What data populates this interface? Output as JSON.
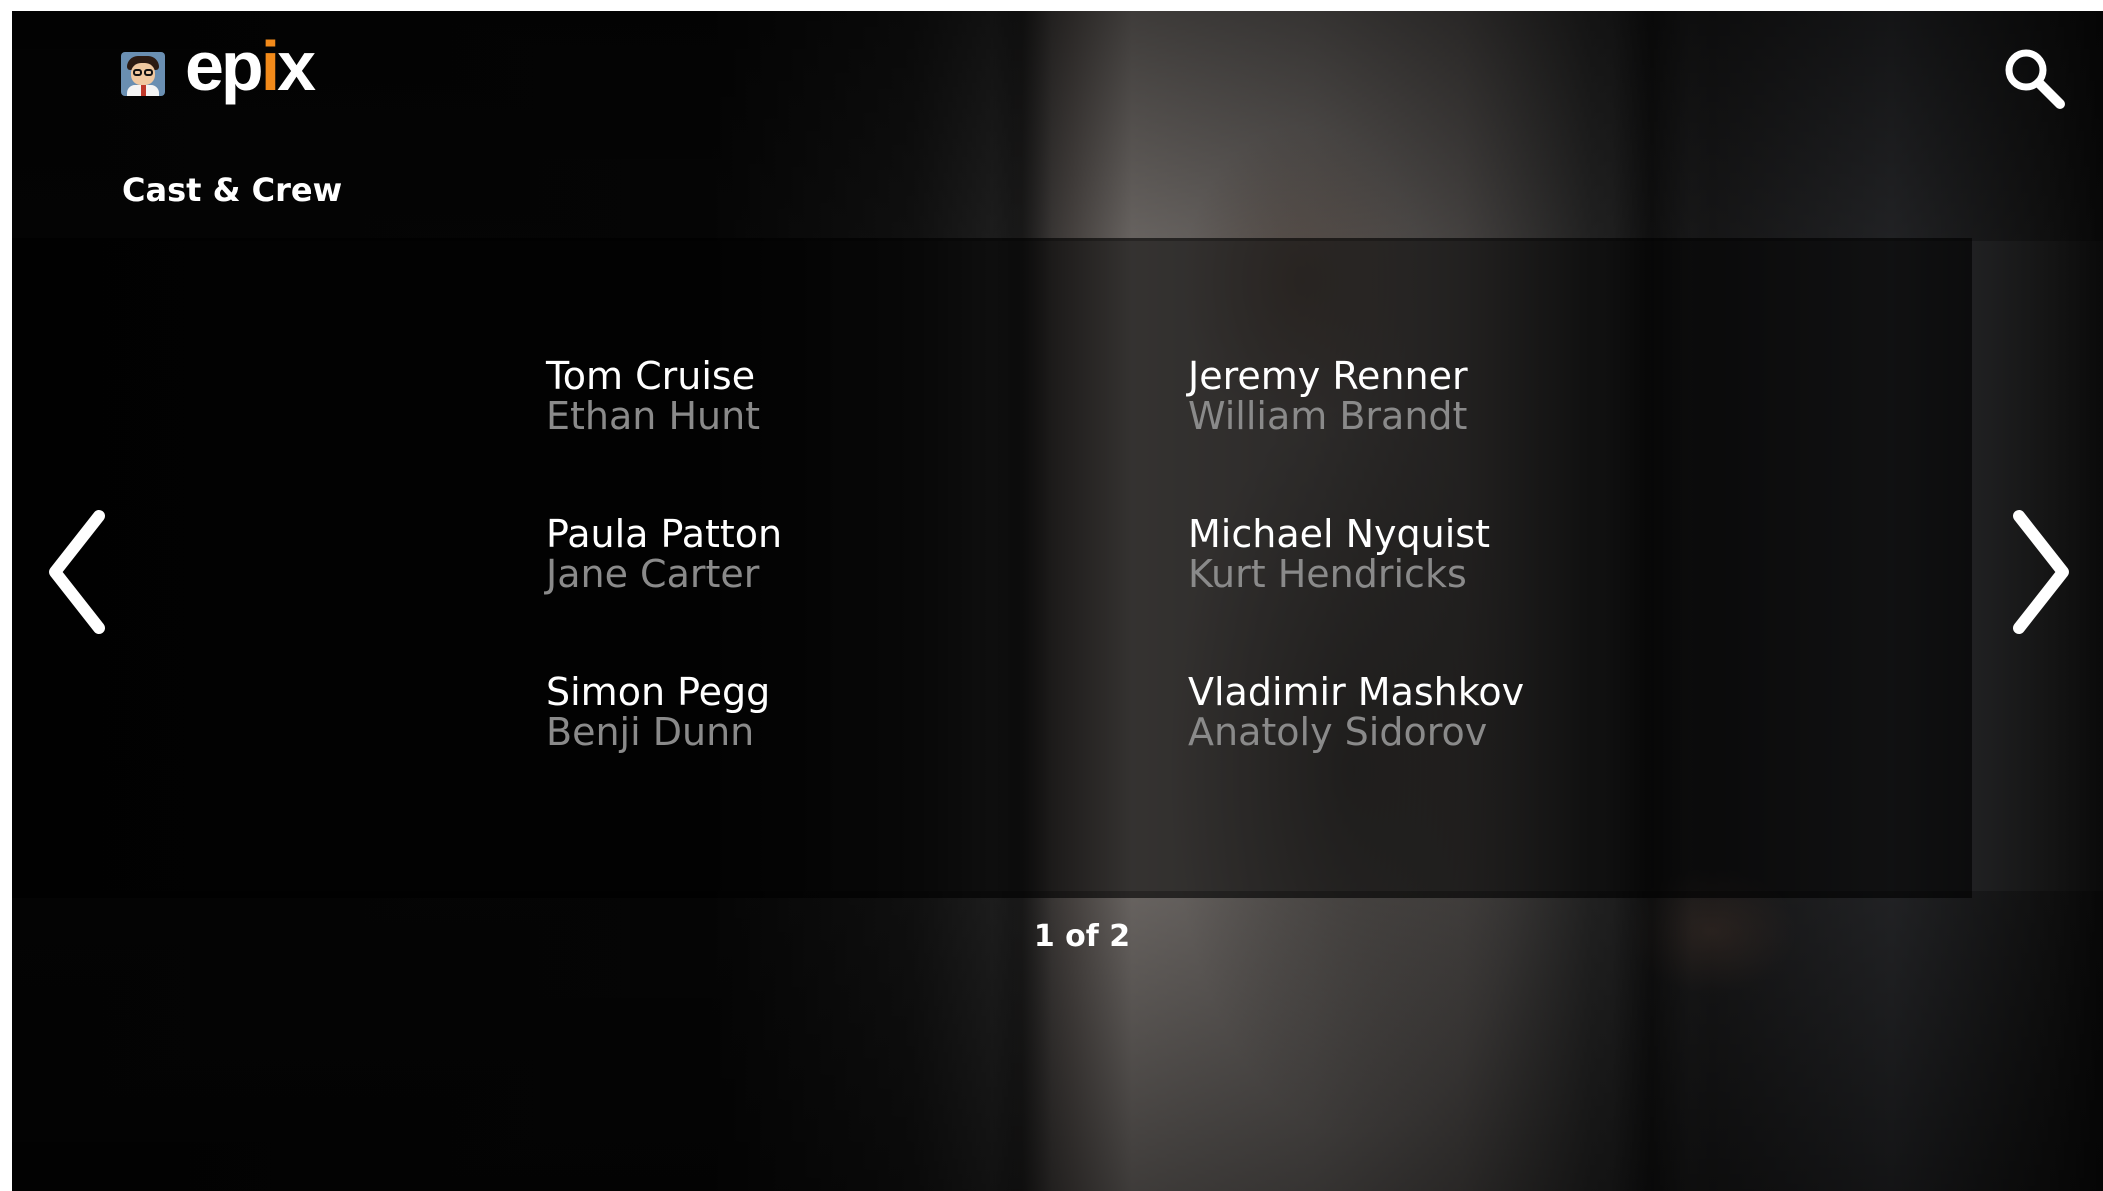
{
  "app": {
    "brand_prefix": "ep",
    "brand_accent": "i",
    "brand_suffix": "x",
    "accent_color": "#f28a1a"
  },
  "header": {
    "search_icon": "search-icon",
    "avatar_icon": "profile-avatar"
  },
  "section": {
    "title": "Cast & Crew"
  },
  "cast": [
    {
      "actor": "Tom Cruise",
      "role": "Ethan Hunt"
    },
    {
      "actor": "Jeremy Renner",
      "role": "William Brandt"
    },
    {
      "actor": "Paula Patton",
      "role": "Jane Carter"
    },
    {
      "actor": "Michael Nyquist",
      "role": "Kurt Hendricks"
    },
    {
      "actor": "Simon Pegg",
      "role": "Benji Dunn"
    },
    {
      "actor": "Vladimir Mashkov",
      "role": "Anatoly Sidorov"
    }
  ],
  "pagination": {
    "label": "1 of 2",
    "current": 1,
    "total": 2
  },
  "navigation": {
    "prev_icon": "chevron-left-icon",
    "next_icon": "chevron-right-icon"
  }
}
